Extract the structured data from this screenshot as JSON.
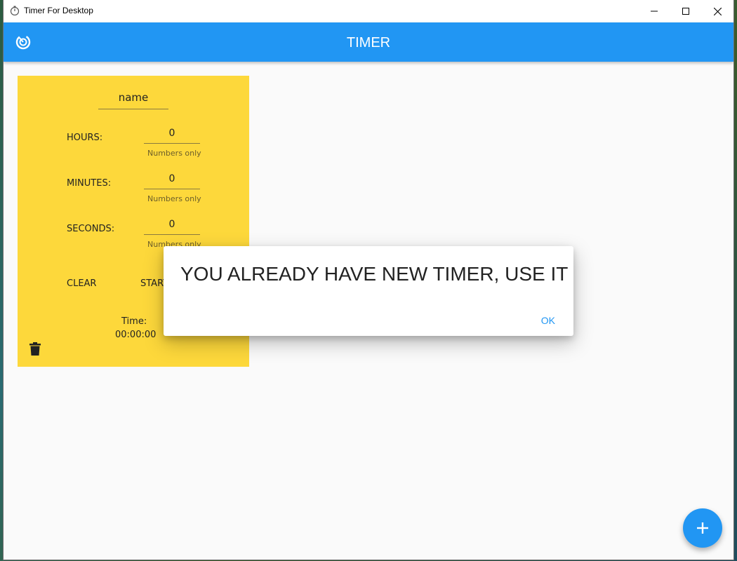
{
  "window": {
    "title": "Timer For Desktop",
    "icons": {
      "app": "stopwatch-icon",
      "minimize": "minimize-icon",
      "maximize": "maximize-icon",
      "close": "close-icon"
    }
  },
  "appbar": {
    "title": "TIMER",
    "logo_icon": "timer-logo-icon",
    "color": "#2196f3"
  },
  "timer_card": {
    "color": "#fdd83b",
    "name_value": "name",
    "hours": {
      "label": "HOURS:",
      "value": "0",
      "helper": "Numbers only"
    },
    "minutes": {
      "label": "MINUTES:",
      "value": "0",
      "helper": "Numbers only"
    },
    "seconds": {
      "label": "SECONDS:",
      "value": "0",
      "helper": "Numbers only"
    },
    "clear_label": "CLEAR",
    "start_label": "START",
    "time_label": "Time:",
    "time_value": "00:00:00",
    "delete_icon": "trash-icon"
  },
  "dialog": {
    "message": "YOU ALREADY HAVE NEW TIMER, USE IT",
    "ok_label": "OK"
  },
  "fab": {
    "icon": "plus-icon"
  }
}
